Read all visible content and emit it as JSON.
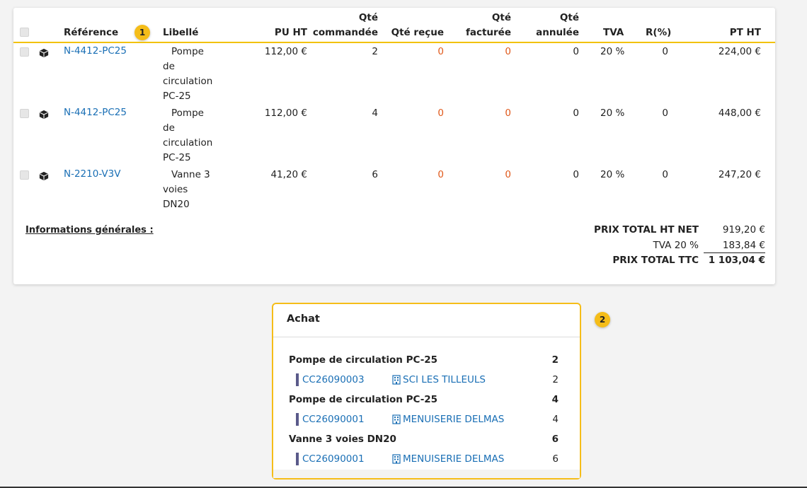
{
  "table": {
    "headers": {
      "reference": "Référence",
      "libelle": "Libellé",
      "pu_ht": "PU HT",
      "qte_commandee_1": "Qté",
      "qte_commandee_2": "commandée",
      "qte_recue": "Qté reçue",
      "qte_facturee_1": "Qté",
      "qte_facturee_2": "facturée",
      "qte_annulee_1": "Qté",
      "qte_annulee_2": "annulée",
      "tva": "TVA",
      "remise": "R(%)",
      "pt_ht": "PT HT"
    },
    "rows": [
      {
        "reference": "N-4412-PC25",
        "libelle_lines": [
          "Pompe",
          "de",
          "circulation",
          "PC-25"
        ],
        "pu_ht": "112,00 €",
        "qte_commandee": "2",
        "qte_recue": "0",
        "qte_facturee": "0",
        "qte_annulee": "0",
        "tva": "20 %",
        "remise": "0",
        "pt_ht": "224,00 €"
      },
      {
        "reference": "N-4412-PC25",
        "libelle_lines": [
          "Pompe",
          "de",
          "circulation",
          "PC-25"
        ],
        "pu_ht": "112,00 €",
        "qte_commandee": "4",
        "qte_recue": "0",
        "qte_facturee": "0",
        "qte_annulee": "0",
        "tva": "20 %",
        "remise": "0",
        "pt_ht": "448,00 €"
      },
      {
        "reference": "N-2210-V3V",
        "libelle_lines": [
          "Vanne 3",
          "voies",
          "DN20"
        ],
        "pu_ht": "41,20 €",
        "qte_commandee": "6",
        "qte_recue": "0",
        "qte_facturee": "0",
        "qte_annulee": "0",
        "tva": "20 %",
        "remise": "0",
        "pt_ht": "247,20 €"
      }
    ]
  },
  "info_label": "Informations générales :",
  "totals": {
    "ht_net_label": "PRIX TOTAL HT NET",
    "ht_net_value": "919,20 €",
    "tva_label": "TVA 20 %",
    "tva_value": "183,84 €",
    "ttc_label": "PRIX TOTAL TTC",
    "ttc_value": "1 103,04 €"
  },
  "badges": {
    "one": "1",
    "two": "2"
  },
  "achat": {
    "title": "Achat",
    "groups": [
      {
        "product": "Pompe de circulation PC-25",
        "qty": "2",
        "order": "CC26090003",
        "client": "SCI LES TILLEULS",
        "line_qty": "2"
      },
      {
        "product": "Pompe de circulation PC-25",
        "qty": "4",
        "order": "CC26090001",
        "client": "MENUISERIE DELMAS",
        "line_qty": "4"
      },
      {
        "product": "Vanne 3 voies DN20",
        "qty": "6",
        "order": "CC26090001",
        "client": "MENUISERIE DELMAS",
        "line_qty": "6"
      }
    ]
  },
  "colors": {
    "accent": "#f5bd19",
    "link": "#1a6fb5",
    "zero_highlight": "#e0591b"
  },
  "icons": {
    "row_icon": "package-icon",
    "client_icon": "building-icon"
  }
}
